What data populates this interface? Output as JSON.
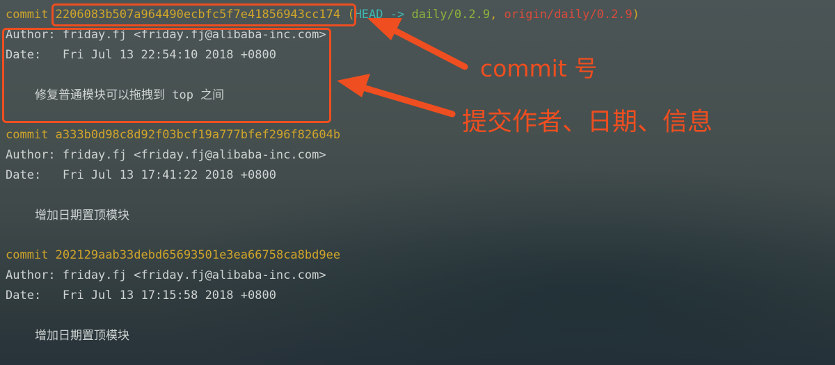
{
  "commits": [
    {
      "commit_label": "commit",
      "hash": "2206083b507a964490ecbfc5f7e41856943cc174",
      "refs": {
        "open": " (",
        "head": "HEAD",
        "arrow": " -> ",
        "branch": "daily/0.2.9",
        "sep": ", ",
        "remote": "origin/daily/0.2.9",
        "close": ")"
      },
      "author": "Author: friday.fj <friday.fj@alibaba-inc.com>",
      "date": "Date:   Fri Jul 13 22:54:10 2018 +0800",
      "message": "修复普通模块可以拖拽到 top 之间"
    },
    {
      "commit_label": "commit",
      "hash": "a333b0d98c8d92f03bcf19a777bfef296f82604b",
      "author": "Author: friday.fj <friday.fj@alibaba-inc.com>",
      "date": "Date:   Fri Jul 13 17:41:22 2018 +0800",
      "message": "增加日期置顶模块"
    },
    {
      "commit_label": "commit",
      "hash": "202129aab33debd65693501e3ea66758ca8bd9ee",
      "author": "Author: friday.fj <friday.fj@alibaba-inc.com>",
      "date": "Date:   Fri Jul 13 17:15:58 2018 +0800",
      "message": "增加日期置顶模块"
    }
  ],
  "annotations": {
    "commit_number": "commit 号",
    "author_date_info": "提交作者、日期、信息"
  },
  "colors": {
    "commit_label": "#d0a52a",
    "head": "#3fb6b0",
    "branch": "#8cb33c",
    "remote": "#d94b3c",
    "annotation": "#ee4e20",
    "text": "#cfd3d2"
  }
}
